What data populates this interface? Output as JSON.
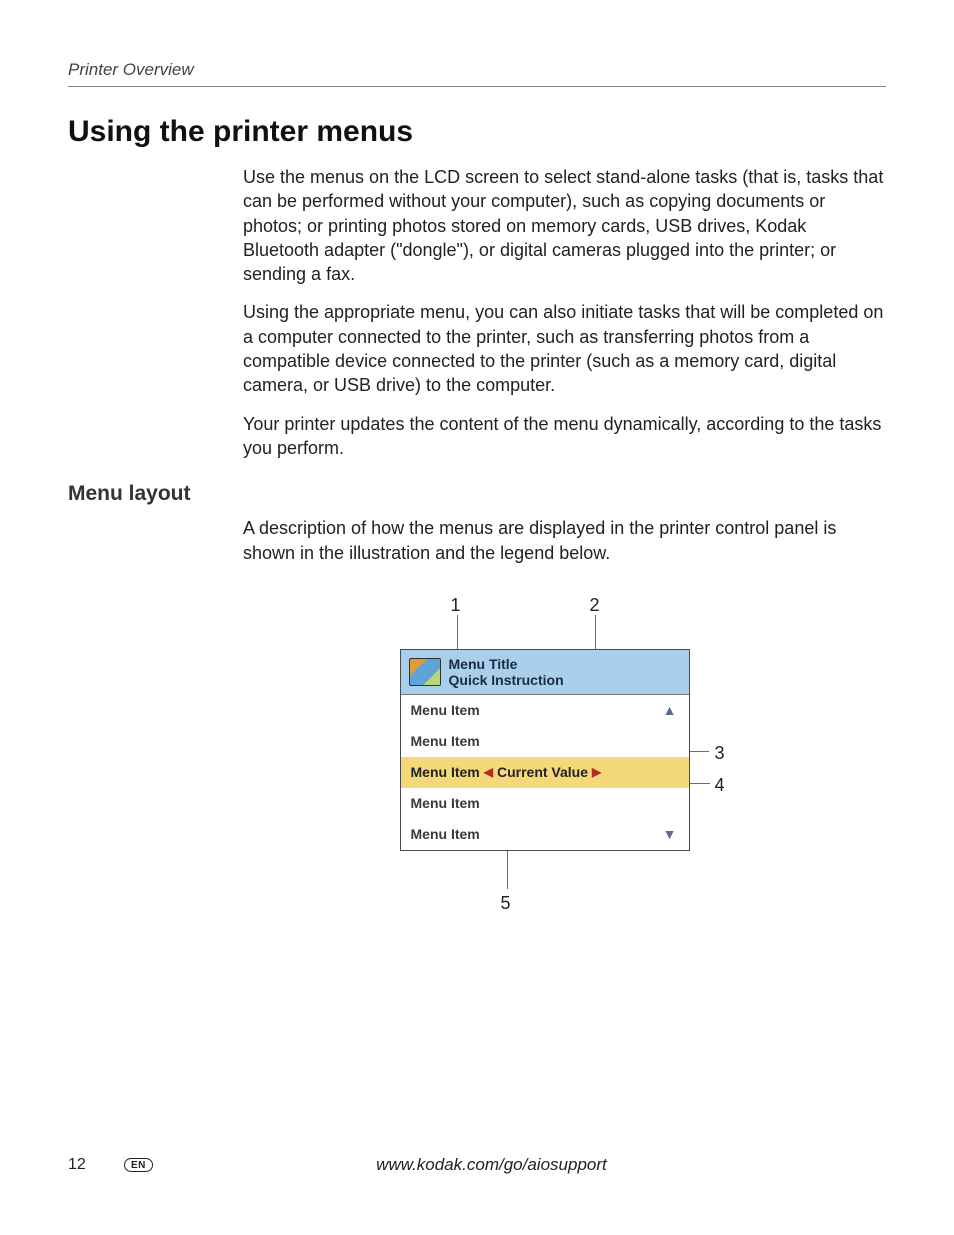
{
  "header": {
    "running": "Printer Overview"
  },
  "section": {
    "title": "Using the printer menus",
    "paragraphs": [
      "Use the menus on the LCD screen to select stand-alone tasks (that is, tasks that can be performed without your computer), such as copying documents or photos; or printing photos stored on memory cards, USB drives, Kodak Bluetooth adapter (\"dongle\"), or digital cameras plugged into the printer; or sending a fax.",
      "Using the appropriate menu, you can also initiate tasks that will be completed on a computer connected to the printer, such as transferring photos from a compatible device connected to the printer (such as a memory card, digital camera, or USB drive) to the computer.",
      "Your printer updates the content of the menu dynamically, according to the tasks you perform."
    ]
  },
  "subsection": {
    "title": "Menu layout",
    "paragraph": "A description of how the menus are displayed in the printer control panel is shown in the illustration and the legend below."
  },
  "diagram": {
    "callouts": {
      "c1": "1",
      "c2": "2",
      "c3": "3",
      "c4": "4",
      "c5": "5"
    },
    "lcd": {
      "title": "Menu Title",
      "subtitle": "Quick Instruction",
      "rows": [
        "Menu Item",
        "Menu Item",
        "Menu Item",
        "Menu Item",
        "Menu Item"
      ],
      "current_value": "Current Value"
    }
  },
  "footer": {
    "page": "12",
    "lang": "EN",
    "url": "www.kodak.com/go/aiosupport"
  }
}
